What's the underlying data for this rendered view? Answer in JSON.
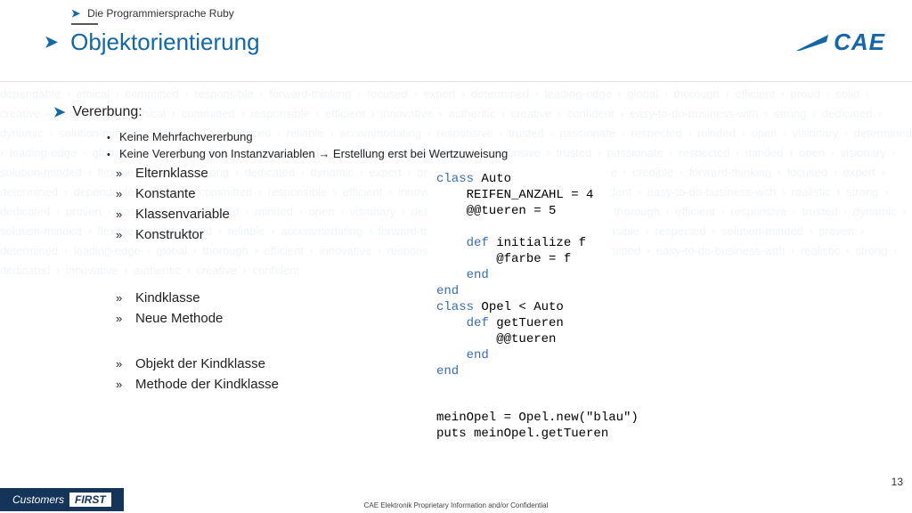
{
  "header": {
    "breadcrumb": "Die Programmiersprache Ruby",
    "title": "Objektorientierung",
    "logo_text": "CAE"
  },
  "section": {
    "heading": "Vererbung:",
    "bullets": [
      "Keine Mehrfachvererbung",
      "Keine Vererbung von Instanzvariablen   → Erstellung erst bei Wertzuweisung"
    ],
    "group1": [
      "Elternklasse",
      "Konstante",
      "Klassenvariable",
      "Konstruktor"
    ],
    "group2": [
      "Kindklasse",
      "Neue Methode"
    ],
    "group3": [
      "Objekt der Kindklasse",
      "Methode der Kindklasse"
    ]
  },
  "code1": {
    "l1a": "class",
    "l1b": " Auto",
    "l2": "    REIFEN_ANZAHL = 4",
    "l3": "    @@tueren = 5",
    "l4": "",
    "l5a": "    def",
    "l5b": " initialize f",
    "l6": "        @farbe = f",
    "l7a": "    end",
    "l8a": "end",
    "l9a": "class",
    "l9b": " Opel < Auto",
    "l10a": "    def",
    "l10b": " getTueren",
    "l11": "        @@tueren",
    "l12a": "    end",
    "l13a": "end"
  },
  "code2": {
    "l1": "meinOpel = Opel.new(\"blau\")",
    "l2": "puts meinOpel.getTueren"
  },
  "footer": {
    "customers": "Customers",
    "first": "FIRST",
    "confidential": "CAE Elektronik Proprietary Information and/or Confidential",
    "page": "13"
  },
  "bg_text": "dependable › ethical › committed › responsible › forward-thinking › focused › expert › determined › leading-edge › global › thorough › efficient › proud › solid › creative › dependable › ethical › committed › responsible › efficient › innovative › authentic › creative › confident › easy-to-do-business-with › strong › dedicated › dynamic › solution-minded › flexible › experienced › reliable › accommodating › responsive › trusted › passionate › respected › minded › open › visionary › determined › leading-edge › global › thorough › efficient › experienced › reliable › accommodating › responsive › trusted › passionate › respected › minded › open › visionary › solution-minded › flexible › leader › strong › dedicated › dynamic › expert › proud › solid › creative › responsible › credible › forward-thinking › focused › expert › determined › dependable › ethical › committed › responsible › efficient › innovative › authentic › creative › confident › easy-to-do-business-with › realistic › strong › dedicated › proven › passionate › respected › minded › open › visionary › determined › leading-edge › global › thorough › efficient › responsive › trusted › dynamic › solution-minded › flexible › experienced › reliable › accommodating › forward-thinking › focused › expert › responsible › respected › solution-minded › proven › determined › leading-edge › global › thorough › efficient › innovative › responsible › dependable › ethical › committed › easy-to-do-business-with › realistic › strong › dedicated › innovative › authentic › creative › confident"
}
